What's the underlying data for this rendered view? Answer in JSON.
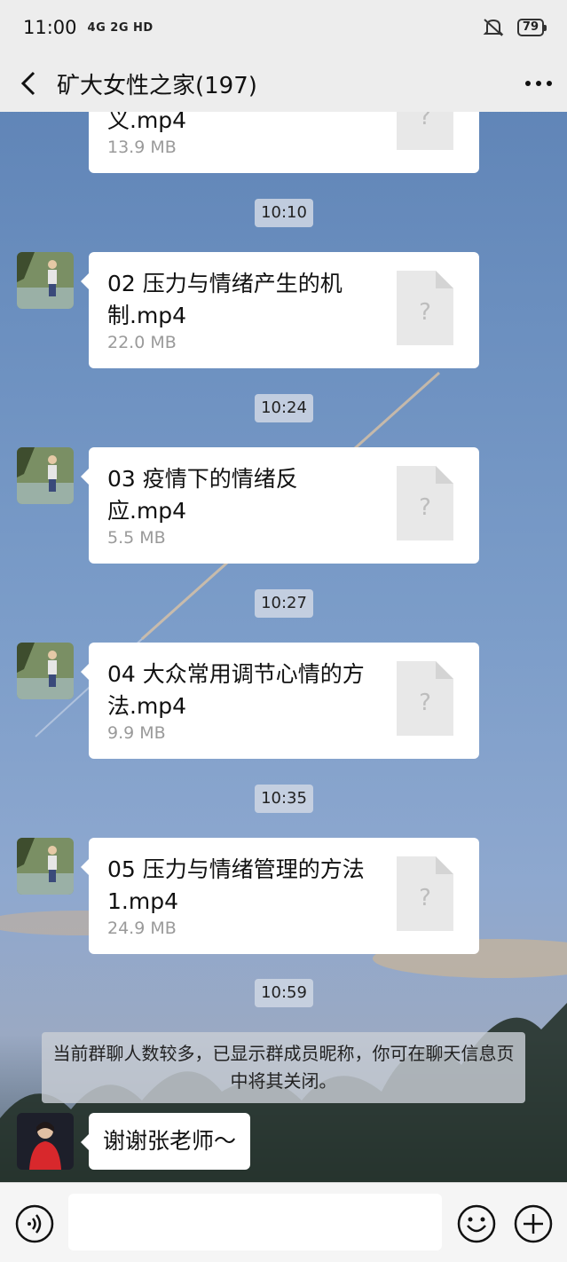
{
  "status_bar": {
    "time": "11:00",
    "network": "4G 2G HD",
    "battery": "79",
    "icons": [
      "signal-4g-icon",
      "signal-2g-icon",
      "wifi-icon",
      "mute-icon",
      "battery-icon"
    ]
  },
  "nav": {
    "title": "矿大女性之家(197)",
    "back_icon": "chevron-left-icon",
    "more_icon": "more-dots-icon"
  },
  "messages": [
    {
      "type": "file",
      "name": "义.mp4",
      "size": "13.9 MB",
      "avatar": "landscape-avatar"
    },
    {
      "type": "time",
      "text": "10:10"
    },
    {
      "type": "file",
      "name": "02 压力与情绪产生的机制.mp4",
      "size": "22.0 MB",
      "avatar": "landscape-avatar"
    },
    {
      "type": "time",
      "text": "10:24"
    },
    {
      "type": "file",
      "name": "03 疫情下的情绪反应.mp4",
      "size": "5.5 MB",
      "avatar": "landscape-avatar"
    },
    {
      "type": "time",
      "text": "10:27"
    },
    {
      "type": "file",
      "name": "04 大众常用调节心情的方法.mp4",
      "size": "9.9 MB",
      "avatar": "landscape-avatar"
    },
    {
      "type": "time",
      "text": "10:35"
    },
    {
      "type": "file",
      "name": "05 压力与情绪管理的方法1.mp4",
      "size": "24.9 MB",
      "avatar": "landscape-avatar"
    },
    {
      "type": "time",
      "text": "10:59"
    },
    {
      "type": "system",
      "text": "当前群聊人数较多，已显示群成员昵称，你可在聊天信息页中将其关闭。"
    },
    {
      "type": "text",
      "text": "谢谢张老师～",
      "avatar": "person-avatar"
    }
  ],
  "input_bar": {
    "voice_icon": "voice-icon",
    "input_value": "",
    "emoji_icon": "emoji-icon",
    "plus_icon": "plus-icon"
  },
  "colors": {
    "bar_bg": "#ededed",
    "bubble_bg": "#ffffff",
    "time_chip_bg": "#cdd5e2",
    "file_size": "#9a9a9a"
  }
}
